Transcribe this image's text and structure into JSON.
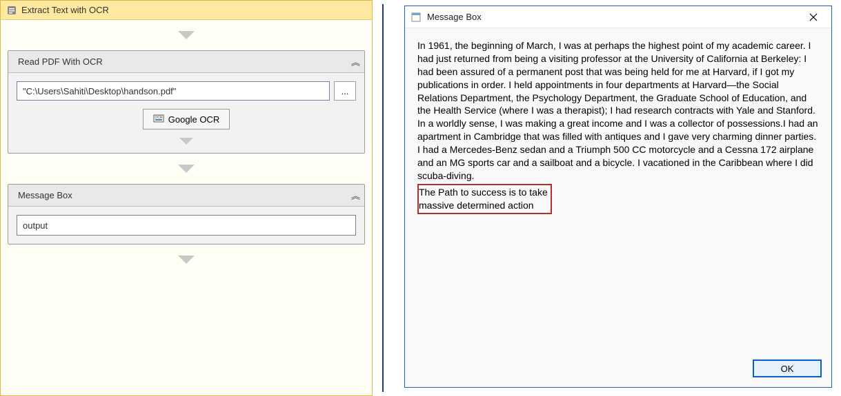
{
  "left": {
    "title": "Extract Text with OCR",
    "readPdf": {
      "title": "Read PDF With OCR",
      "path": "\"C:\\Users\\Sahiti\\Desktop\\handson.pdf\"",
      "browse": "...",
      "engineButton": "Google OCR"
    },
    "messageBox": {
      "title": "Message Box",
      "value": "output"
    }
  },
  "dialog": {
    "title": "Message Box",
    "paragraph": "In 1961, the beginning of March, I was at perhaps the highest point of my academic career. I had just returned from being a visiting professor at the University of California at Berkeley: I had been assured of a permanent post that was being held for me at Harvard, if I got my publications in order. I held appointments in four departments at Harvard—the Social Relations Department, the Psychology Department, the Graduate School of Education, and the Health Service (where I was a therapist); I had research contracts with Yale and Stanford. In a worldly sense, I was making a great income and I was a collector of possessions.I had an apartment in Cambridge that was filled with antiques and I gave very charming dinner parties. I had a Mercedes-Benz sedan and a Triumph 500 CC motorcycle and a Cessna 172 airplane and an MG sports car and a sailboat and a bicycle. I vacationed in the Caribbean where I did scuba-diving.",
    "highlighted": "The Path to success is to take\nmassive determined action",
    "ok": "OK"
  }
}
